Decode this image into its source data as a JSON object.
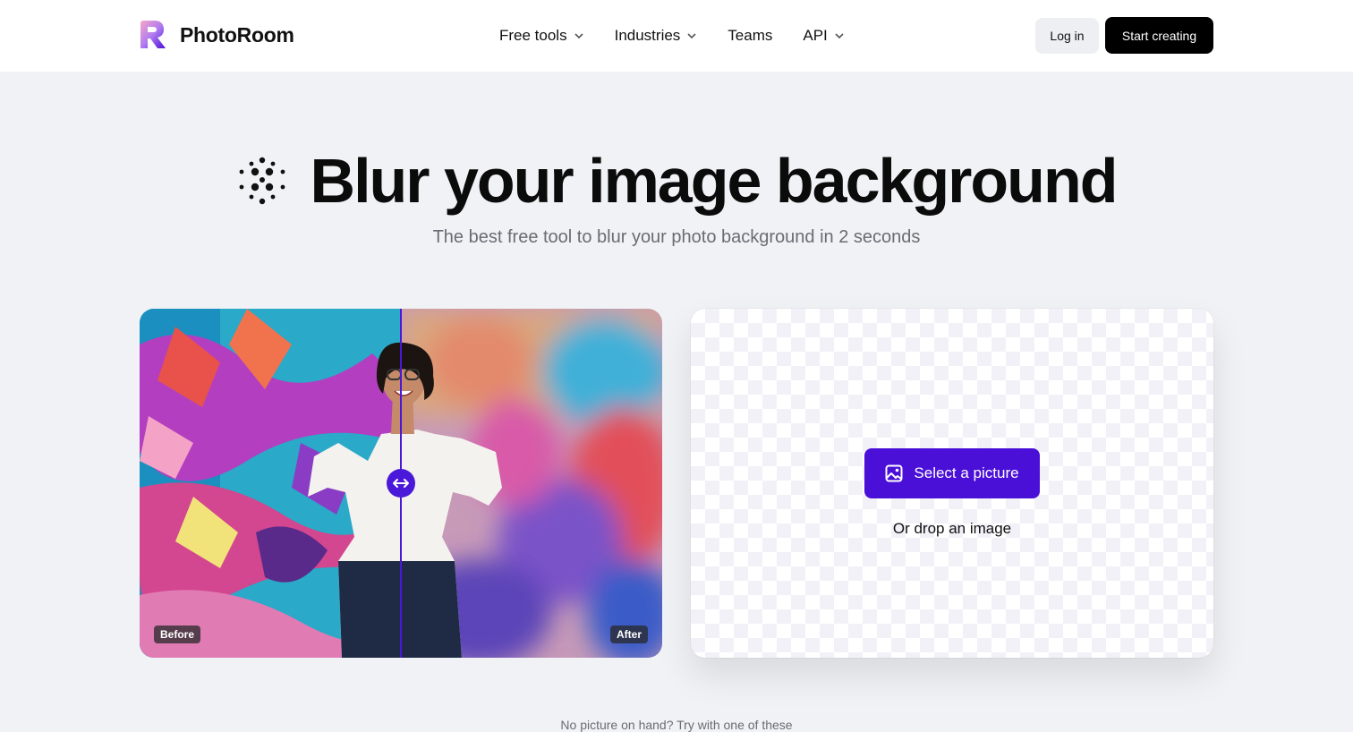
{
  "brand": {
    "name": "PhotoRoom"
  },
  "nav": {
    "items": [
      {
        "label": "Free tools",
        "has_dropdown": true
      },
      {
        "label": "Industries",
        "has_dropdown": true
      },
      {
        "label": "Teams",
        "has_dropdown": false
      },
      {
        "label": "API",
        "has_dropdown": true
      }
    ],
    "login_label": "Log in",
    "start_label": "Start creating"
  },
  "hero": {
    "title": "Blur your image background",
    "subtitle": "The best free tool to blur your photo background in 2 seconds",
    "icon": "blur-dots-icon"
  },
  "compare": {
    "before_label": "Before",
    "after_label": "After",
    "slider_position": 0.5
  },
  "upload": {
    "select_label": "Select a picture",
    "drop_label": "Or drop an image"
  },
  "footer_hint": "No picture on hand? Try with one of these",
  "colors": {
    "accent": "#4a10d8",
    "page_bg": "#f1f2f6",
    "dark_button": "#000000"
  }
}
